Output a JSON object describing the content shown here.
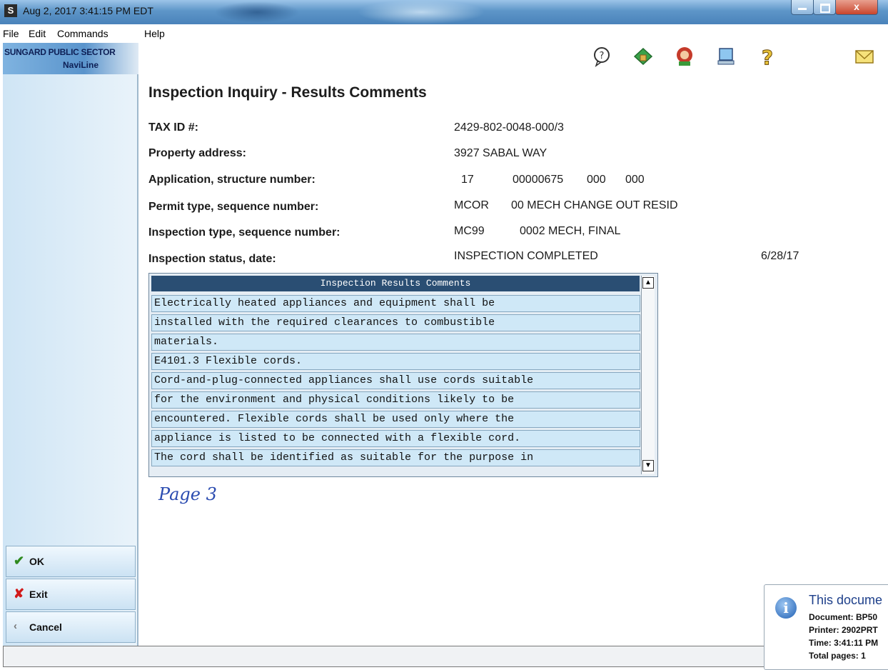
{
  "window": {
    "title": "Aug 2, 2017  3:41:15 PM EDT",
    "app_icon_letter": "S",
    "close_glyph": "x"
  },
  "menu": [
    "File",
    "Edit",
    "Commands",
    "Help"
  ],
  "logo": {
    "line1": "SUNGARD PUBLIC SECTOR",
    "line2": "NaviLine"
  },
  "toolbar_icons": [
    "help-bubble-icon",
    "home-icon",
    "user-icon",
    "computer-icon",
    "question-mark-icon",
    "mail-icon"
  ],
  "sidebar": {
    "ok_label": "OK",
    "exit_label": "Exit",
    "cancel_label": "Cancel",
    "colors": {
      "ok": "#2f8a1f",
      "exit": "#d11a1a"
    }
  },
  "page": {
    "title": "Inspection Inquiry - Results Comments",
    "fields": {
      "tax_id_label": "TAX ID #:",
      "tax_id": "2429-802-0048-000/3",
      "address_label": "Property address:",
      "address": "3927 SABAL WAY",
      "application_label": "Application, structure number:",
      "application": [
        "17",
        "00000675",
        "000",
        "000"
      ],
      "permit_label": "Permit type, sequence number:",
      "permit_type": "MCOR",
      "permit_desc": "00 MECH CHANGE OUT RESID",
      "insp_type_label": "Inspection type, sequence number:",
      "insp_type": "MC99",
      "insp_desc": "0002 MECH, FINAL",
      "status_label": "Inspection status, date:",
      "status": "INSPECTION COMPLETED",
      "status_date": "6/28/17"
    }
  },
  "comments": {
    "header": "Inspection Results Comments",
    "lines": [
      "Electrically heated appliances and equipment shall be",
      "installed with the required clearances to combustible",
      "materials.",
      "E4101.3 Flexible cords.",
      "Cord-and-plug-connected appliances shall use cords suitable",
      "for the environment and physical conditions likely to be",
      "encountered. Flexible cords shall be used only where the",
      "appliance is listed to be connected with a flexible cord.",
      "The cord shall be identified as suitable for the purpose in"
    ]
  },
  "handwritten_note": "Page 3",
  "notification": {
    "title": "This docume",
    "document": "Document: BP50",
    "printer": "Printer: 2902PRT",
    "time": "Time: 3:41:11 PM",
    "total_pages": "Total pages: 1"
  }
}
